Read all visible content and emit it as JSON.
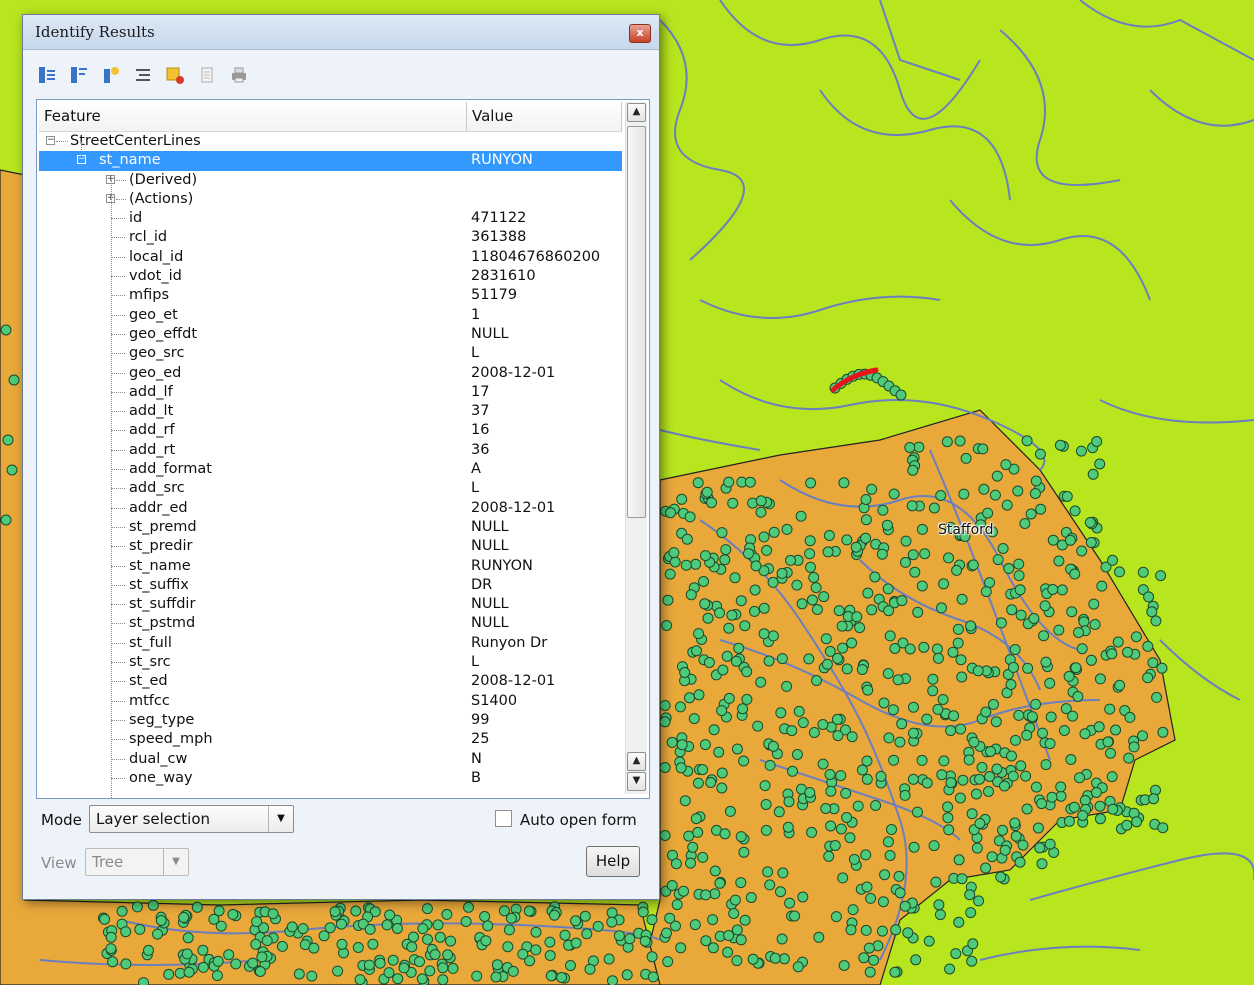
{
  "window": {
    "title": "Identify Results",
    "close_label": "x"
  },
  "toolbar": {
    "icons": [
      "expand-all-icon",
      "collapse-all-icon",
      "expand-new-icon",
      "layer-tree-icon",
      "clear-highlights-icon",
      "copy-icon",
      "print-icon"
    ]
  },
  "tree": {
    "col_feature": "Feature",
    "col_value": "Value",
    "layer": "StreetCenterLines",
    "feature_name": "st_name",
    "feature_value": "RUNYON",
    "derived": "(Derived)",
    "actions": "(Actions)",
    "attributes": [
      {
        "name": "id",
        "value": "471122"
      },
      {
        "name": "rcl_id",
        "value": "361388"
      },
      {
        "name": "local_id",
        "value": "11804676860200"
      },
      {
        "name": "vdot_id",
        "value": "2831610"
      },
      {
        "name": "mfips",
        "value": "51179"
      },
      {
        "name": "geo_et",
        "value": "1"
      },
      {
        "name": "geo_effdt",
        "value": "NULL"
      },
      {
        "name": "geo_src",
        "value": "L"
      },
      {
        "name": "geo_ed",
        "value": "2008-12-01"
      },
      {
        "name": "add_lf",
        "value": "17"
      },
      {
        "name": "add_lt",
        "value": "37"
      },
      {
        "name": "add_rf",
        "value": "16"
      },
      {
        "name": "add_rt",
        "value": "36"
      },
      {
        "name": "add_format",
        "value": "A"
      },
      {
        "name": "add_src",
        "value": "L"
      },
      {
        "name": "addr_ed",
        "value": "2008-12-01"
      },
      {
        "name": "st_premd",
        "value": "NULL"
      },
      {
        "name": "st_predir",
        "value": "NULL"
      },
      {
        "name": "st_name",
        "value": "RUNYON"
      },
      {
        "name": "st_suffix",
        "value": "DR"
      },
      {
        "name": "st_suffdir",
        "value": "NULL"
      },
      {
        "name": "st_pstmd",
        "value": "NULL"
      },
      {
        "name": "st_full",
        "value": "Runyon Dr"
      },
      {
        "name": "st_src",
        "value": "L"
      },
      {
        "name": "st_ed",
        "value": "2008-12-01"
      },
      {
        "name": "mtfcc",
        "value": "S1400"
      },
      {
        "name": "seg_type",
        "value": "99"
      },
      {
        "name": "speed_mph",
        "value": "25"
      },
      {
        "name": "dual_cw",
        "value": "N"
      },
      {
        "name": "one_way",
        "value": "B"
      }
    ]
  },
  "bottom": {
    "mode_label": "Mode",
    "mode_value": "Layer selection",
    "auto_open_label": "Auto open form",
    "view_label": "View",
    "view_value": "Tree",
    "help_label": "Help"
  },
  "map": {
    "place_label": "Stafford",
    "colors": {
      "background": "#b7e51e",
      "area_fill": "#e8a83a",
      "roads": "#6b7fbf",
      "points": "#4ecb7a",
      "highlight": "#e8141c"
    }
  }
}
